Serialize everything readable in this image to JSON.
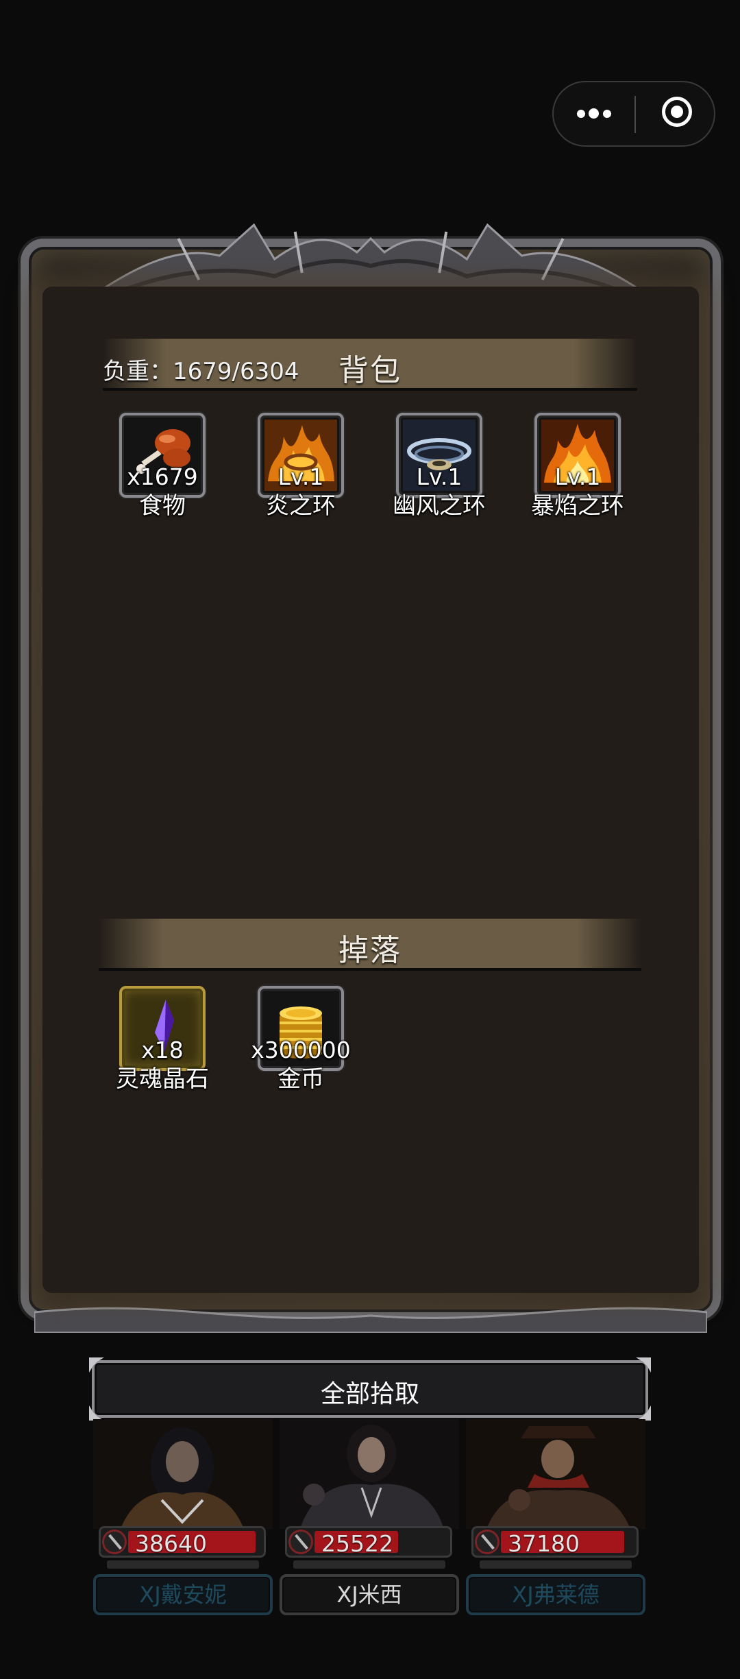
{
  "capsule": {
    "more_icon": "more-dots-icon",
    "close_icon": "target-circle-icon"
  },
  "bag": {
    "title": "背包",
    "load_label": "负重：1679/6304",
    "items": [
      {
        "qty": "x1679",
        "name": "食物",
        "icon": "meat-drumstick-icon"
      },
      {
        "qty": "Lv.1",
        "name": "炎之环",
        "icon": "flame-ring-icon"
      },
      {
        "qty": "Lv.1",
        "name": "幽风之环",
        "icon": "wind-ring-icon"
      },
      {
        "qty": "Lv.1",
        "name": "暴焰之环",
        "icon": "blaze-ring-icon"
      }
    ]
  },
  "drops": {
    "title": "掉落",
    "items": [
      {
        "qty": "x18",
        "name": "灵魂晶石",
        "icon": "soul-crystal-icon"
      },
      {
        "qty": "x300000",
        "name": "金币",
        "icon": "gold-coins-icon"
      }
    ]
  },
  "actions": {
    "pick_all": "全部拾取"
  },
  "heroes": [
    {
      "hp": "38640",
      "hp_fraction": 0.95,
      "name": "XJ戴安妮",
      "active": false
    },
    {
      "hp": "25522",
      "hp_fraction": 0.62,
      "name": "XJ米西",
      "active": true
    },
    {
      "hp": "37180",
      "hp_fraction": 0.92,
      "name": "XJ弗莱德",
      "active": false
    }
  ],
  "colors": {
    "panel_bg": "#221d19",
    "header_band": "#6b5d45",
    "hp_red": "#a3151a"
  }
}
